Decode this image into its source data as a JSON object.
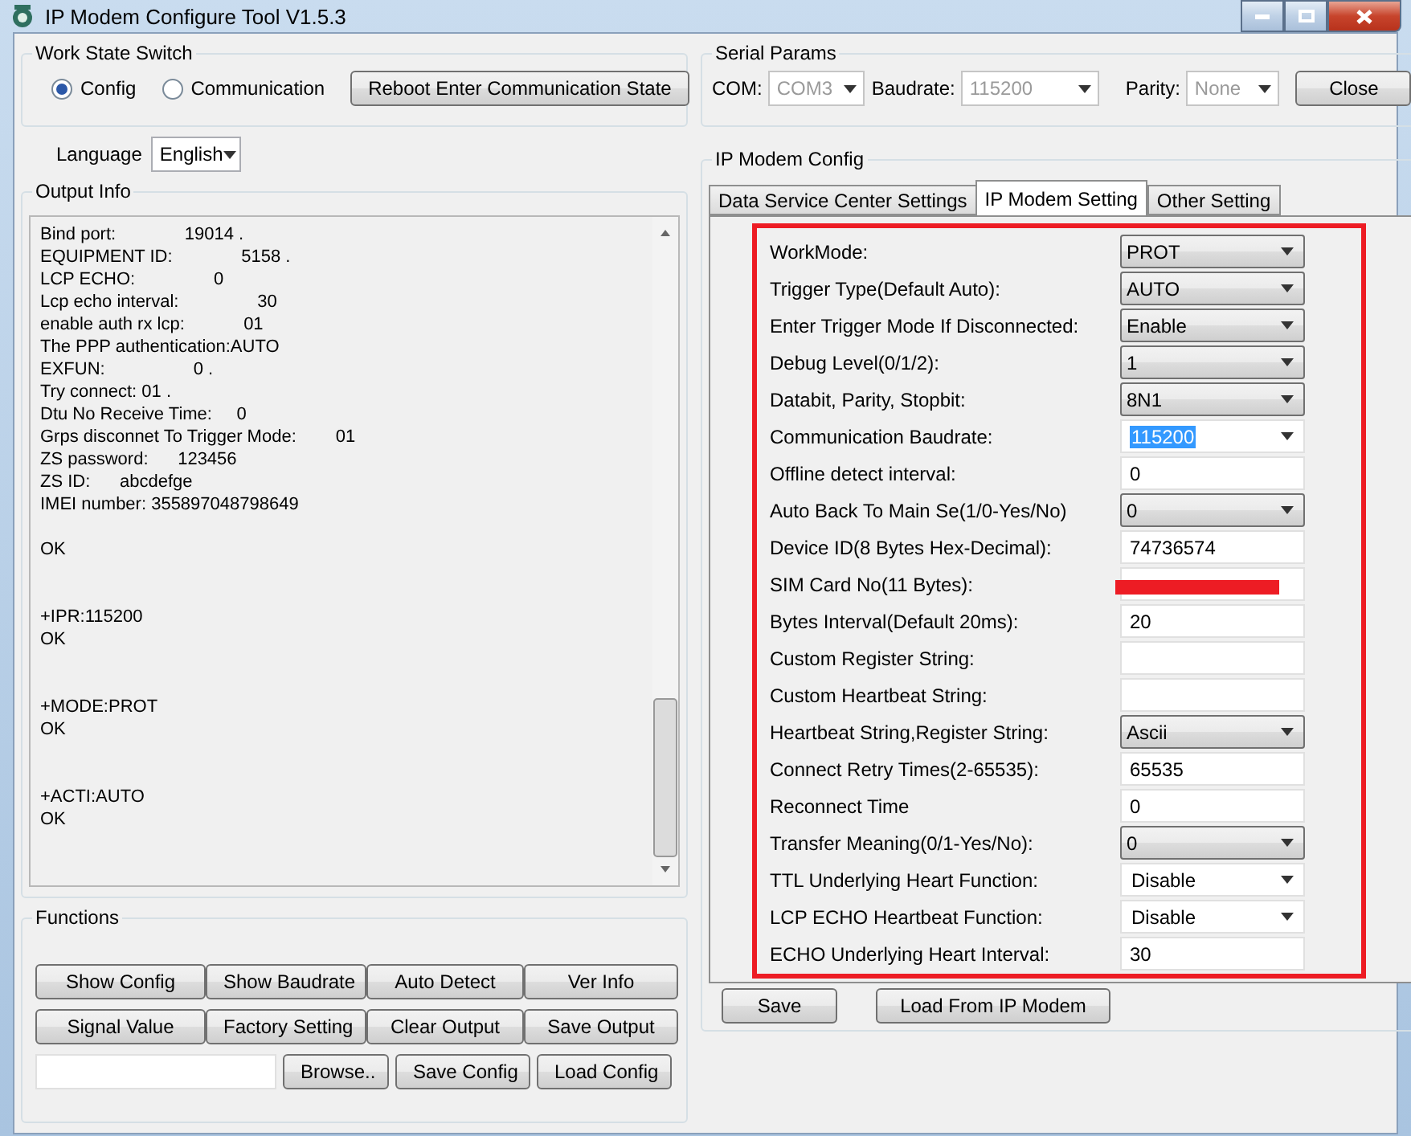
{
  "window": {
    "title": "IP Modem Configure Tool V1.5.3"
  },
  "work_state": {
    "title": "Work State Switch",
    "options": [
      {
        "label": "Config",
        "selected": true
      },
      {
        "label": "Communication",
        "selected": false
      }
    ],
    "button": "Reboot Enter Communication State"
  },
  "language": {
    "label": "Language",
    "value": "English"
  },
  "output": {
    "title": "Output Info",
    "blocks": [
      {
        "lines": [
          "Bind port:              19014 .",
          "EQUIPMENT ID:              5158 .",
          "LCP ECHO:                0",
          "Lcp echo interval:                30",
          "enable auth rx lcp:            01",
          "The PPP authentication:AUTO",
          "EXFUN:                  0 .",
          "Try connect: 01 .",
          "Dtu No Receive Time:     0",
          "Grps disconnet To Trigger Mode:        01",
          "ZS password:      123456",
          "ZS ID:      abcdefge",
          "IMEI number: 355897048798649"
        ]
      },
      {
        "lines": [
          "OK"
        ]
      },
      {
        "lines": [
          "+IPR:115200",
          "OK"
        ]
      },
      {
        "lines": [
          "+MODE:PROT",
          "OK"
        ]
      },
      {
        "lines": [
          "+ACTI:AUTO",
          "OK"
        ]
      }
    ]
  },
  "functions": {
    "title": "Functions",
    "rows": [
      [
        "Show Config",
        "Show Baudrate",
        "Auto Detect",
        "Ver Info"
      ],
      [
        "Signal Value",
        "Factory Setting",
        "Clear Output",
        "Save Output"
      ]
    ],
    "file_buttons": [
      "Browse..",
      "Save Config",
      "Load Config"
    ]
  },
  "serial": {
    "title": "Serial Params",
    "fields": [
      {
        "label": "COM:",
        "value": "COM3",
        "disabled": true
      },
      {
        "label": "Baudrate:",
        "value": "115200",
        "disabled": true
      },
      {
        "label": "Parity:",
        "value": "None",
        "disabled": true
      }
    ],
    "button": "Close"
  },
  "modem_config": {
    "title": "IP Modem Config",
    "tabs": [
      {
        "label": "Data Service Center Settings",
        "selected": false
      },
      {
        "label": "IP Modem Setting",
        "selected": true
      },
      {
        "label": "Other Setting",
        "selected": false
      }
    ],
    "highlighted": true,
    "settings": [
      {
        "label": "WorkMode:",
        "kind": "dropdown",
        "value": "PROT"
      },
      {
        "label": "Trigger Type(Default Auto):",
        "kind": "dropdown",
        "value": "AUTO"
      },
      {
        "label": "Enter Trigger Mode If Disconnected:",
        "kind": "dropdown",
        "value": "Enable"
      },
      {
        "label": "Debug Level(0/1/2):",
        "kind": "dropdown",
        "value": "1"
      },
      {
        "label": "Databit, Parity, Stopbit:",
        "kind": "dropdown",
        "value": "8N1"
      },
      {
        "label": "Communication Baudrate:",
        "kind": "combo",
        "value": "115200",
        "text_selected": true
      },
      {
        "label": "Offline detect interval:",
        "kind": "input",
        "value": "0"
      },
      {
        "label": "Auto Back To Main Se(1/0-Yes/No)",
        "kind": "dropdown",
        "value": "0"
      },
      {
        "label": "Device ID(8 Bytes Hex-Decimal):",
        "kind": "input",
        "value": "74736574"
      },
      {
        "label": "SIM Card No(11 Bytes):",
        "kind": "input",
        "redacted": true
      },
      {
        "label": "Bytes Interval(Default 20ms):",
        "kind": "input",
        "value": "20"
      },
      {
        "label": "Custom Register String:",
        "kind": "input"
      },
      {
        "label": "Custom Heartbeat String:",
        "kind": "input"
      },
      {
        "label": "Heartbeat String,Register String:",
        "kind": "dropdown",
        "value": "Ascii"
      },
      {
        "label": "Connect Retry Times(2-65535):",
        "kind": "input",
        "value": "65535"
      },
      {
        "label": "Reconnect Time",
        "kind": "input",
        "value": "0"
      },
      {
        "label": "Transfer Meaning(0/1-Yes/No):",
        "kind": "dropdown",
        "value": "0"
      },
      {
        "label": "TTL Underlying Heart Function:",
        "kind": "combo",
        "value": "Disable",
        "text_selected": false
      },
      {
        "label": "LCP ECHO Heartbeat Function:",
        "kind": "combo",
        "value": "Disable",
        "text_selected": false
      },
      {
        "label": "ECHO Underlying Heart Interval:",
        "kind": "input",
        "value": "30"
      }
    ],
    "buttons": [
      "Save",
      "Load From IP Modem"
    ]
  }
}
